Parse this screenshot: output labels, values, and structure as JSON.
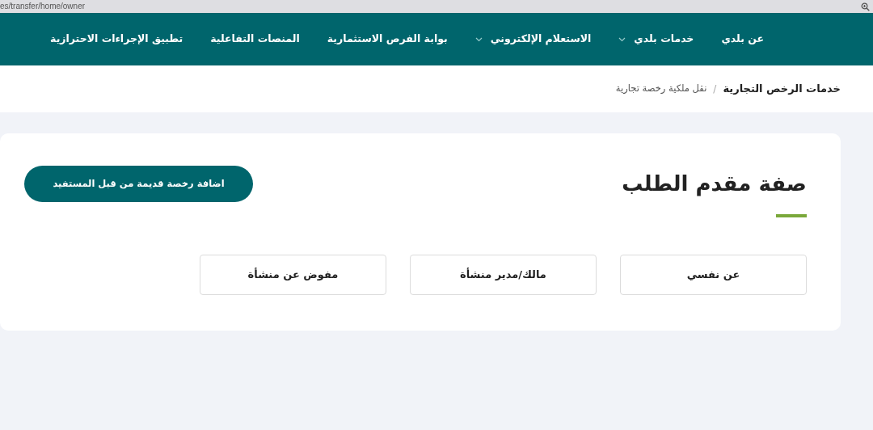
{
  "browser": {
    "url": "es/transfer/home/owner"
  },
  "nav": {
    "items": [
      {
        "label": "عن بلدي",
        "dropdown": false
      },
      {
        "label": "خدمات بلدي",
        "dropdown": true
      },
      {
        "label": "الاستعلام الإلكتروني",
        "dropdown": true
      },
      {
        "label": "بوابة الفرص الاستثمارية",
        "dropdown": false
      },
      {
        "label": "المنصات التفاعلية",
        "dropdown": false
      },
      {
        "label": "تطبيق الإجراءات الاحترازية",
        "dropdown": false
      }
    ]
  },
  "breadcrumb": {
    "items": [
      "خدمات الرخص التجارية",
      "نقل ملكية رخصة تجارية"
    ],
    "separator": "/"
  },
  "card": {
    "title": "صفة مقدم الطلب",
    "action_button": "اضافة رخصة قديمة من قبل المستفيد",
    "options": [
      "عن نفسي",
      "مالك/مدير منشأة",
      "مفوض عن منشأة"
    ]
  }
}
